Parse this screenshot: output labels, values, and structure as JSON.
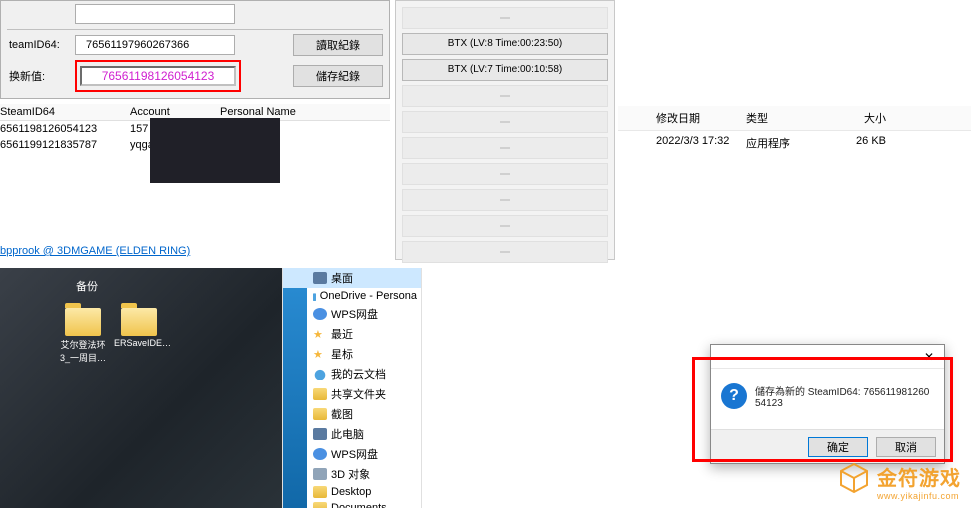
{
  "editor": {
    "steamid64_label": "teamID64:",
    "steamid64_value": "76561197960267366",
    "read_btn": "讀取紀錄",
    "newval_label": "换新值:",
    "newval_value": "76561198126054123",
    "save_btn": "儲存紀錄"
  },
  "accounts": {
    "headers": [
      "SteamID64",
      "Account",
      "Personal Name"
    ],
    "rows": [
      {
        "id": "6561198126054123",
        "acct": "157",
        "name": ""
      },
      {
        "id": "6561199121835787",
        "acct": "yqga",
        "name": ""
      }
    ]
  },
  "footer_link": "bpprook @ 3DMGAME (ELDEN RING)",
  "slots": {
    "s1": "BTX (LV:8 Time:00:23:50)",
    "s2": "BTX (LV:7 Time:00:10:58)"
  },
  "explorer": {
    "headers": {
      "date": "修改日期",
      "type": "类型",
      "size": "大小"
    },
    "row": {
      "date": "2022/3/3 17:32",
      "type": "应用程序",
      "size": "26 KB"
    }
  },
  "desktop": {
    "backup_label": "备份",
    "icon1": "艾尔登法环3_一周目…",
    "icon2": "ERSaveIDE…"
  },
  "tree": [
    {
      "ico": "ico-pc",
      "label": "桌面",
      "sel": true
    },
    {
      "ico": "ico-cloud",
      "label": "OneDrive - Persona"
    },
    {
      "ico": "ico-wps",
      "label": "WPS网盘"
    },
    {
      "ico": "ico-star",
      "label": "最近",
      "star": true
    },
    {
      "ico": "ico-star",
      "label": "星标",
      "star": true
    },
    {
      "ico": "ico-cloud",
      "label": "我的云文档"
    },
    {
      "ico": "ico-folder",
      "label": "共享文件夹"
    },
    {
      "ico": "ico-folder",
      "label": "截图"
    },
    {
      "ico": "ico-pc",
      "label": "此电脑"
    },
    {
      "ico": "ico-wps",
      "label": "WPS网盘"
    },
    {
      "ico": "ico-disk",
      "label": "3D 对象"
    },
    {
      "ico": "ico-folder",
      "label": "Desktop"
    },
    {
      "ico": "ico-folder",
      "label": "Documents"
    }
  ],
  "dialog": {
    "message": "儲存為新的 SteamID64: 76561198126054123",
    "ok": "确定",
    "cancel": "取消"
  },
  "watermark": {
    "cn": "金符游戏",
    "en": "www.yikajinfu.com"
  }
}
